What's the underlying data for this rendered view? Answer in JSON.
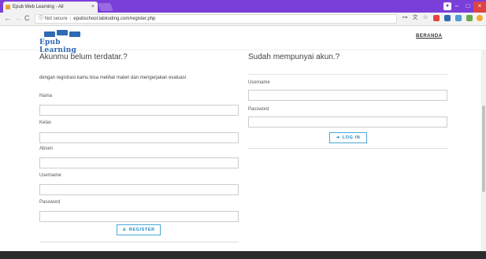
{
  "browser": {
    "tab_title": "Epub Web Learning - All",
    "tab_close": "×",
    "not_secure": "Not secure",
    "url": "epubschool.labkoding.com/register.php",
    "win_min": "–",
    "win_max": "□",
    "win_close": "×"
  },
  "site": {
    "logo_text": "Epub Learning",
    "nav_home": "BERANDA"
  },
  "register": {
    "heading": "Akunmu belum terdatar.?",
    "description": "dengan registrasi kamu bisa melihat materi dan mengerjakan evaluasi",
    "fields": [
      {
        "label": "Nama"
      },
      {
        "label": "Kelas"
      },
      {
        "label": "Absen"
      },
      {
        "label": "Username"
      },
      {
        "label": "Password"
      }
    ],
    "button_label": "REGISTER"
  },
  "login": {
    "heading": "Sudah mempunyai akun.?",
    "username_label": "Username",
    "password_label": "Password",
    "button_label": "LOG IN"
  },
  "colors": {
    "chrome_tabstrip": "#7b3fd9",
    "brand_blue": "#2f69b3",
    "button_blue": "#1e88c7",
    "footer": "#2c2c2c"
  }
}
